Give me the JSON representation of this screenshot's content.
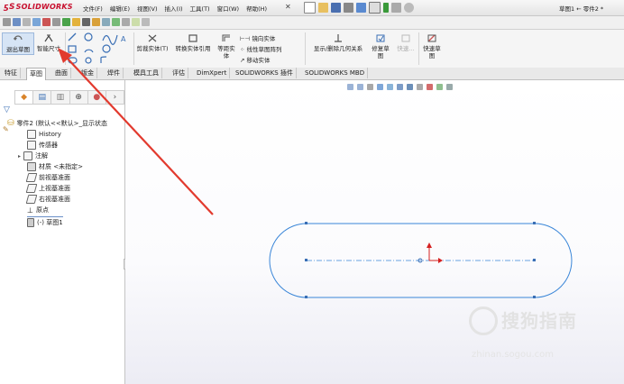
{
  "app": {
    "logo": "SOLIDWORKS",
    "doc_title": "草图1 ← 零件2 *"
  },
  "menu": [
    "文件(F)",
    "编辑(E)",
    "视图(V)",
    "插入(I)",
    "工具(T)",
    "窗口(W)",
    "帮助(H)"
  ],
  "ribbon": {
    "exit_sketch": "退出草图",
    "smart_dimension": "智能尺寸",
    "trim_entities": "剪裁实体(T)",
    "convert_entities": "转换实体引用",
    "offset_entities": "等距实体",
    "mirror_entities": "镜向实体",
    "linear_pattern": "线性草图阵列",
    "move_entities": "移动实体",
    "display_relations": "显示/删除几何关系",
    "repair_sketch": "修复草图",
    "quick_snaps": "快速...",
    "rapid_sketch": "快速草图"
  },
  "command_tabs": [
    "特征",
    "草图",
    "曲面",
    "钣金",
    "焊件",
    "模具工具",
    "评估",
    "DimXpert",
    "SOLIDWORKS 插件",
    "SOLIDWORKS MBD"
  ],
  "active_tab_index": 1,
  "feature_tree": {
    "root": "零件2 (默认<<默认>_显示状态",
    "items": [
      {
        "label": "History",
        "icon": "history-icon"
      },
      {
        "label": "传感器",
        "icon": "sensor-icon"
      },
      {
        "label": "注解",
        "icon": "annotation-icon"
      },
      {
        "label": "材质 <未指定>",
        "icon": "material-icon"
      },
      {
        "label": "前视基准面",
        "icon": "plane-icon"
      },
      {
        "label": "上视基准面",
        "icon": "plane-icon"
      },
      {
        "label": "右视基准面",
        "icon": "plane-icon"
      },
      {
        "label": "原点",
        "icon": "origin-icon"
      },
      {
        "label": "(-) 草图1",
        "icon": "sketch-icon"
      }
    ]
  },
  "watermark": {
    "text": "搜狗指南",
    "url": "zhinan.sogou.com"
  },
  "colors": {
    "sketch_line": "#3a86d8",
    "arrow": "#e23a2e",
    "logo": "#c8102e"
  }
}
